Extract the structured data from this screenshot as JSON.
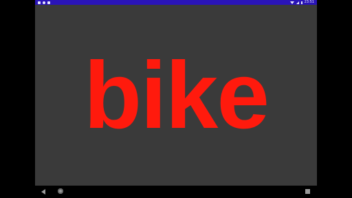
{
  "status_bar": {
    "time": "23:51",
    "color": "#2a14b8",
    "left_icons": [
      "notification-icon",
      "sync-icon",
      "download-icon"
    ],
    "right_icons": [
      "wifi-icon",
      "signal-icon",
      "battery-icon"
    ]
  },
  "main": {
    "word": "bike",
    "word_color": "#ff1a0d",
    "background_color": "#3a3a3a"
  },
  "nav_bar": {
    "icons": [
      "back-icon",
      "home-icon",
      "recents-icon"
    ]
  }
}
